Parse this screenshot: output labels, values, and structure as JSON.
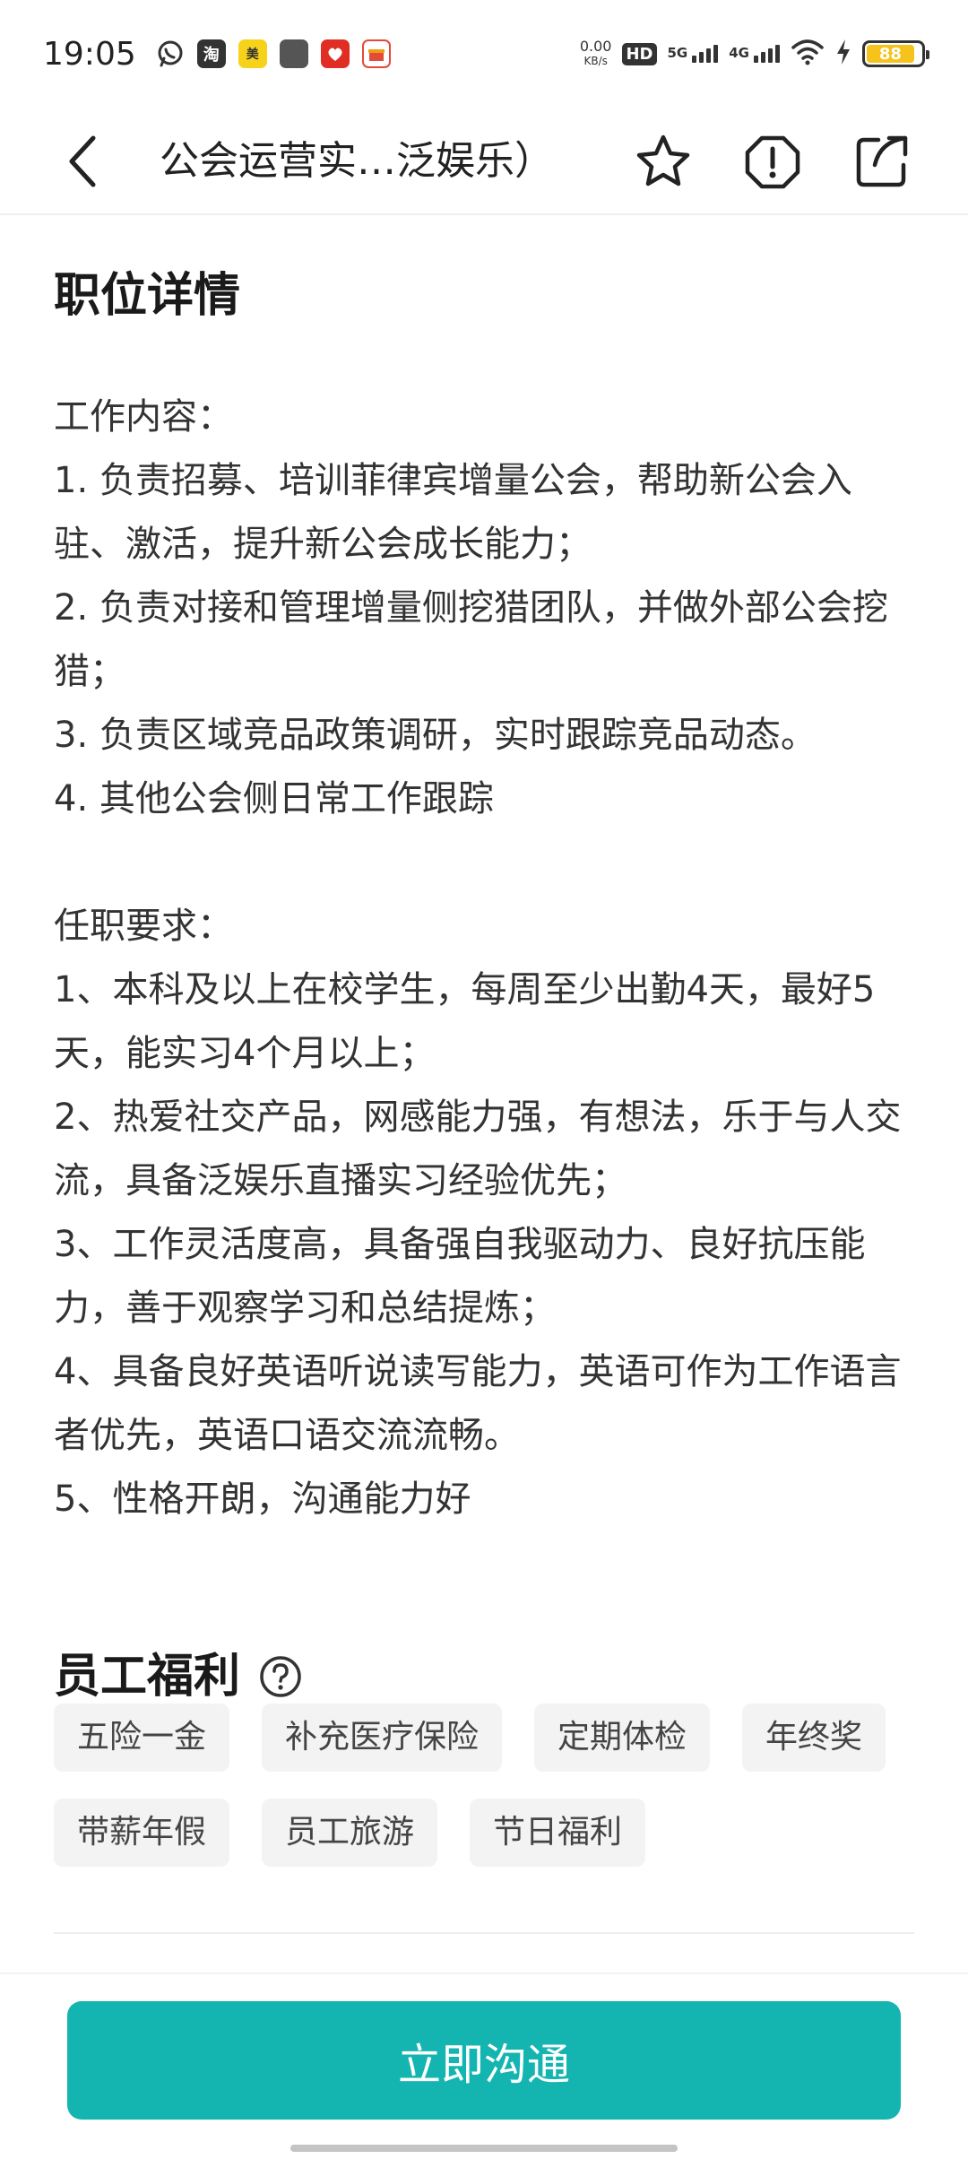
{
  "status_bar": {
    "time": "19:05",
    "net_speed_value": "0.00",
    "net_speed_unit": "KB/s",
    "hd_label": "HD",
    "sim1_label": "5G",
    "sim2_label": "4G",
    "battery_level": "88",
    "icons": [
      "whatsapp-icon",
      "taobao-icon",
      "meituan-icon",
      "app-square-icon",
      "pinduoduo-icon",
      "gift-app-icon",
      "wifi-icon",
      "charging-icon"
    ],
    "colors": {
      "battery_fill": "#f6c21c"
    }
  },
  "nav": {
    "title": "公会运营实…泛娱乐）",
    "icons": [
      "back-icon",
      "star-icon",
      "report-icon",
      "share-icon"
    ]
  },
  "job_details": {
    "section_title": "职位详情",
    "description": "工作内容：\n1. 负责招募、培训菲律宾增量公会，帮助新公会入驻、激活，提升新公会成长能力；\n2. 负责对接和管理增量侧挖猎团队，并做外部公会挖猎；\n3. 负责区域竞品政策调研，实时跟踪竞品动态。\n4. 其他公会侧日常工作跟踪\n\n任职要求：\n1、本科及以上在校学生，每周至少出勤4天，最好5天，能实习4个月以上；\n2、热爱社交产品，网感能力强，有想法，乐于与人交流，具备泛娱乐直播实习经验优先；\n3、工作灵活度高，具备强自我驱动力、良好抗压能力，善于观察学习和总结提炼；\n4、具备良好英语听说读写能力，英语可作为工作语言者优先，英语口语交流流畅。\n5、性格开朗，沟通能力好"
  },
  "benefits": {
    "section_title": "员工福利",
    "tags": [
      "五险一金",
      "补充医疗保险",
      "定期体检",
      "年终奖",
      "带薪年假",
      "员工旅游",
      "节日福利"
    ]
  },
  "bottom": {
    "cta_label": "立即沟通",
    "colors": {
      "cta": "#14b5b1"
    }
  }
}
